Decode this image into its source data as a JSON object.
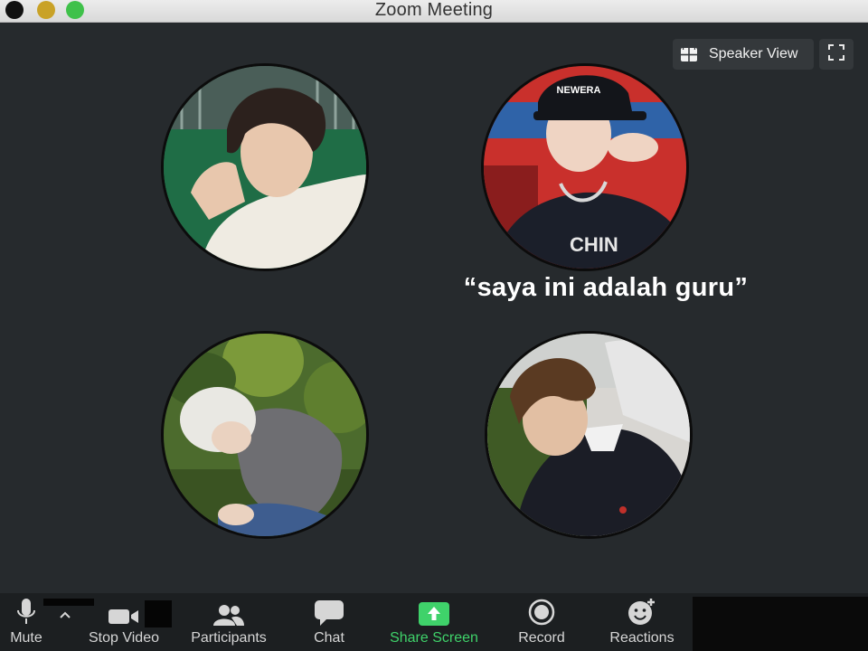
{
  "window": {
    "title": "Zoom Meeting"
  },
  "controls": {
    "speaker_view_label": "Speaker View",
    "speaker_view_icon": "grid-icon",
    "fullscreen_icon": "fullscreen-icon"
  },
  "caption": {
    "text": "“saya ini adalah guru”"
  },
  "participants": [
    {
      "id": "participant-1",
      "description_icon": "video-tile"
    },
    {
      "id": "participant-2",
      "cap_text": "NEWERA",
      "description_icon": "video-tile"
    },
    {
      "id": "participant-3",
      "description_icon": "video-tile"
    },
    {
      "id": "participant-4",
      "description_icon": "video-tile"
    }
  ],
  "toolbar": {
    "mute_label": "Mute",
    "stop_video_label": "Stop Video",
    "participants_label": "Participants",
    "chat_label": "Chat",
    "share_screen_label": "Share Screen",
    "record_label": "Record",
    "reactions_label": "Reactions"
  },
  "colors": {
    "background": "#262a2d",
    "toolbar": "#1c1f21",
    "share_green": "#3fd26a",
    "button_bg": "#34383b"
  }
}
